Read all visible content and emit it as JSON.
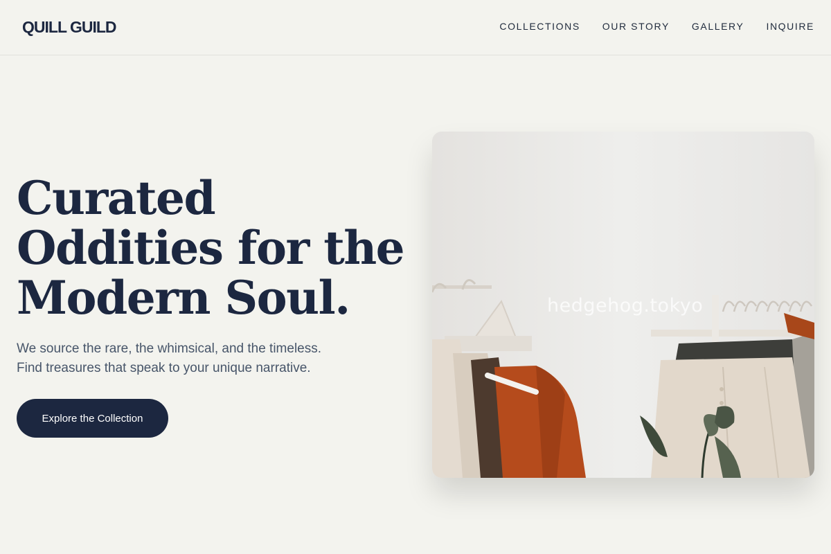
{
  "header": {
    "logo": "QUILL GUILD",
    "nav": [
      {
        "label": "COLLECTIONS"
      },
      {
        "label": "OUR STORY"
      },
      {
        "label": "GALLERY"
      },
      {
        "label": "INQUIRE"
      }
    ]
  },
  "hero": {
    "title_lines": [
      "Curated",
      "Oddities for the",
      "Modern Soul."
    ],
    "subtitle_lines": [
      "We source the rare, the whimsical, and the timeless.",
      "Find treasures that speak to your unique narrative."
    ],
    "cta_label": "Explore the Collection",
    "image": {
      "watermark": "hedgehog.tokyo",
      "description_icon": "clothing-rack-photo"
    }
  },
  "colors": {
    "background": "#f3f3ee",
    "primary": "#1c2740",
    "text_muted": "#475569"
  }
}
